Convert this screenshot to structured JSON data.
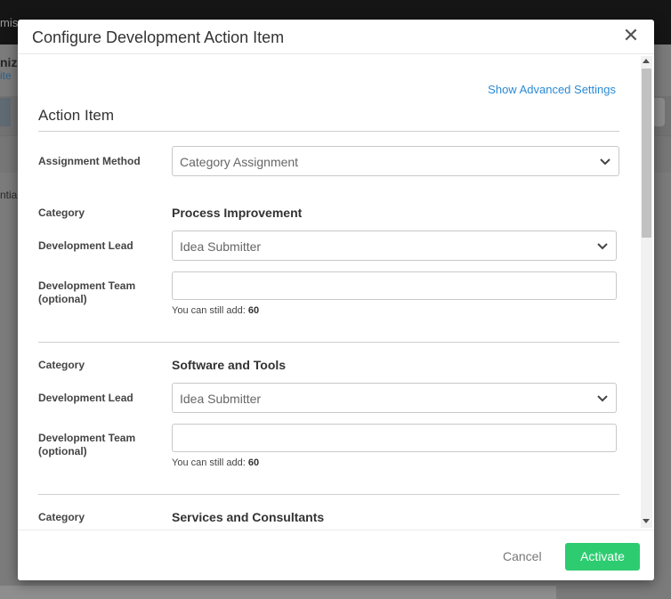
{
  "background": {
    "crumb": "mis",
    "title": "nize",
    "subtitle": "ite",
    "side_text": "ntial"
  },
  "modal": {
    "title": "Configure Development Action Item",
    "close_glyph": "✕",
    "advanced_link": "Show Advanced Settings",
    "section_title": "Action Item",
    "assignment": {
      "label": "Assignment Method",
      "value": "Category Assignment"
    },
    "categories": [
      {
        "category_label": "Category",
        "category_value": "Process Improvement",
        "lead_label": "Development Lead",
        "lead_value": "Idea Submitter",
        "team_label_line1": "Development Team",
        "team_label_line2": "(optional)",
        "hint_prefix": "You can still add:",
        "hint_count": "60"
      },
      {
        "category_label": "Category",
        "category_value": "Software and Tools",
        "lead_label": "Development Lead",
        "lead_value": "Idea Submitter",
        "team_label_line1": "Development Team",
        "team_label_line2": "(optional)",
        "hint_prefix": "You can still add:",
        "hint_count": "60"
      },
      {
        "category_label": "Category",
        "category_value": "Services and Consultants"
      }
    ],
    "footer": {
      "cancel_label": "Cancel",
      "activate_label": "Activate"
    }
  },
  "colors": {
    "accent_link": "#2a8ad4",
    "activate_green": "#2ecc71",
    "overlay": "#7b7b7b"
  },
  "icons": {
    "dropdown": "chevron-down-icon",
    "close": "close-icon"
  }
}
